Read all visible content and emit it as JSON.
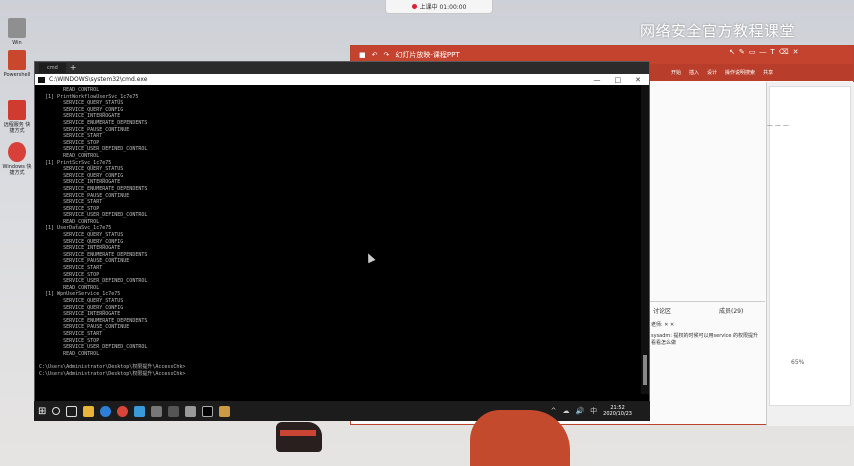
{
  "record_bar": {
    "label": "上课中 01:00:00"
  },
  "watermark": {
    "text": "网络安全官方教程课堂"
  },
  "desktop_icons": [
    {
      "label": "Win",
      "color": "#8f8f8f"
    },
    {
      "label": "Powershell",
      "color": "#c8472d"
    },
    {
      "label": "远程服务 快捷方式",
      "color": "#cf3b2f"
    },
    {
      "label": "Windows 快捷方式",
      "color": "#d8403a"
    }
  ],
  "cmd": {
    "tab_label": "cmd",
    "title_path": "C:\\WINDOWS\\system32\\cmd.exe",
    "controls": [
      "—",
      "□",
      "✕"
    ],
    "lines": [
      "        READ_CONTROL",
      "  [1] PrintWorkflowUserSvc_1c7e75",
      "        SERVICE_QUERY_STATUS",
      "        SERVICE_QUERY_CONFIG",
      "        SERVICE_INTERROGATE",
      "        SERVICE_ENUMERATE_DEPENDENTS",
      "        SERVICE_PAUSE_CONTINUE",
      "        SERVICE_START",
      "        SERVICE_STOP",
      "        SERVICE_USER_DEFINED_CONTROL",
      "        READ_CONTROL",
      "  [1] PrintScrSvc_1c7e75",
      "        SERVICE_QUERY_STATUS",
      "        SERVICE_QUERY_CONFIG",
      "        SERVICE_INTERROGATE",
      "        SERVICE_ENUMERATE_DEPENDENTS",
      "        SERVICE_PAUSE_CONTINUE",
      "        SERVICE_START",
      "        SERVICE_STOP",
      "        SERVICE_USER_DEFINED_CONTROL",
      "        READ_CONTROL",
      "  [1] UserDataSvc_1c7e75",
      "        SERVICE_QUERY_STATUS",
      "        SERVICE_QUERY_CONFIG",
      "        SERVICE_INTERROGATE",
      "        SERVICE_ENUMERATE_DEPENDENTS",
      "        SERVICE_PAUSE_CONTINUE",
      "        SERVICE_START",
      "        SERVICE_STOP",
      "        SERVICE_USER_DEFINED_CONTROL",
      "        READ_CONTROL",
      "  [1] WpnUserService_1c7e75",
      "        SERVICE_QUERY_STATUS",
      "        SERVICE_QUERY_CONFIG",
      "        SERVICE_INTERROGATE",
      "        SERVICE_ENUMERATE_DEPENDENTS",
      "        SERVICE_PAUSE_CONTINUE",
      "        SERVICE_START",
      "        SERVICE_STOP",
      "        SERVICE_USER_DEFINED_CONTROL",
      "        READ_CONTROL",
      "",
      "C:\\Users\\Administrator\\Desktop\\权限提升\\AccessChk>",
      "C:\\Users\\Administrator\\Desktop\\权限提升\\AccessChk>"
    ]
  },
  "ppt": {
    "title": "幻灯片放映-课程PPT",
    "ribbon_items": [
      "开始",
      "插入",
      "设计",
      "操作说明搜索",
      "共享"
    ],
    "dash_label": "— — —",
    "tabs": [
      "讨论区",
      "成员(29)"
    ],
    "chat": [
      "老师: ✕ ✕",
      "sysadm: 提权的时候可以用service 的权限提升",
      "看看怎么做"
    ],
    "zoom": "65%"
  },
  "taskbar": {
    "start_icon": "windows-logo-icon",
    "apps": [
      "search",
      "task-view",
      "explorer",
      "edge",
      "chrome",
      "app1",
      "app2",
      "app3",
      "app4",
      "cmd",
      "app5"
    ],
    "tray": [
      "^",
      "☁",
      "🔊",
      "中"
    ],
    "time": "21:52",
    "date": "2020/10/23"
  }
}
